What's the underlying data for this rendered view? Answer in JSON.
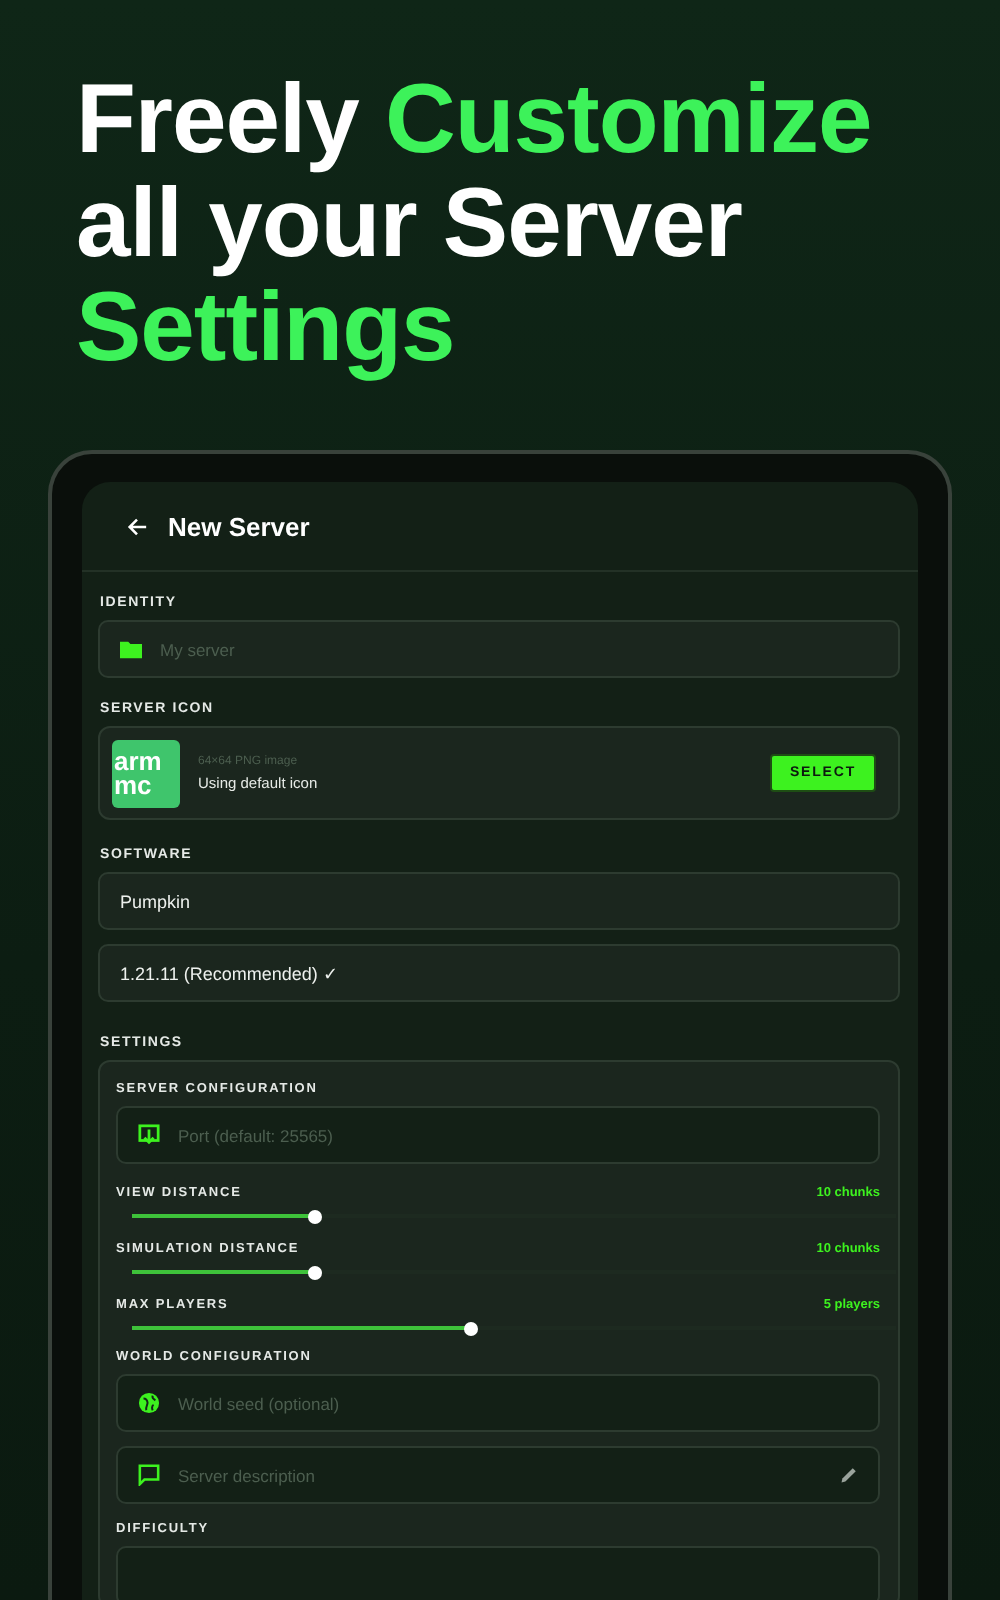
{
  "headline": [
    [
      {
        "text": "Freely ",
        "accent": false
      },
      {
        "text": "Customize",
        "accent": true
      }
    ],
    [
      {
        "text": "all your Server",
        "accent": false
      }
    ],
    [
      {
        "text": "Settings",
        "accent": true
      }
    ]
  ],
  "app_bar": {
    "title": "New Server"
  },
  "identity": {
    "label": "IDENTITY",
    "field": {
      "placeholder": "My server"
    }
  },
  "server_icon": {
    "label": "SERVER ICON",
    "logo_lines": [
      "arm",
      "mc"
    ],
    "caption": "64×64 PNG image",
    "status": "Using default icon",
    "button": "SELECT"
  },
  "software": {
    "label": "SOFTWARE",
    "fields": [
      {
        "value": "Pumpkin"
      },
      {
        "value": "1.21.11 (Recommended) ✓"
      }
    ]
  },
  "settings": {
    "label": "SETTINGS",
    "server_configuration": {
      "title": "SERVER CONFIGURATION",
      "port": {
        "placeholder": "Port (default: 25565)"
      },
      "sliders": [
        {
          "label": "VIEW DISTANCE",
          "reading": "10 chunks",
          "level": 0.24
        },
        {
          "label": "SIMULATION DISTANCE",
          "reading": "10 chunks",
          "level": 0.24
        },
        {
          "label": "MAX PLAYERS",
          "reading": "5 players",
          "level": 0.445
        }
      ]
    },
    "world_configuration": {
      "title": "WORLD CONFIGURATION",
      "seed": {
        "placeholder": "World seed (optional)"
      },
      "description": {
        "placeholder": "Server description"
      }
    },
    "difficulty": {
      "label": "DIFFICULTY"
    }
  }
}
